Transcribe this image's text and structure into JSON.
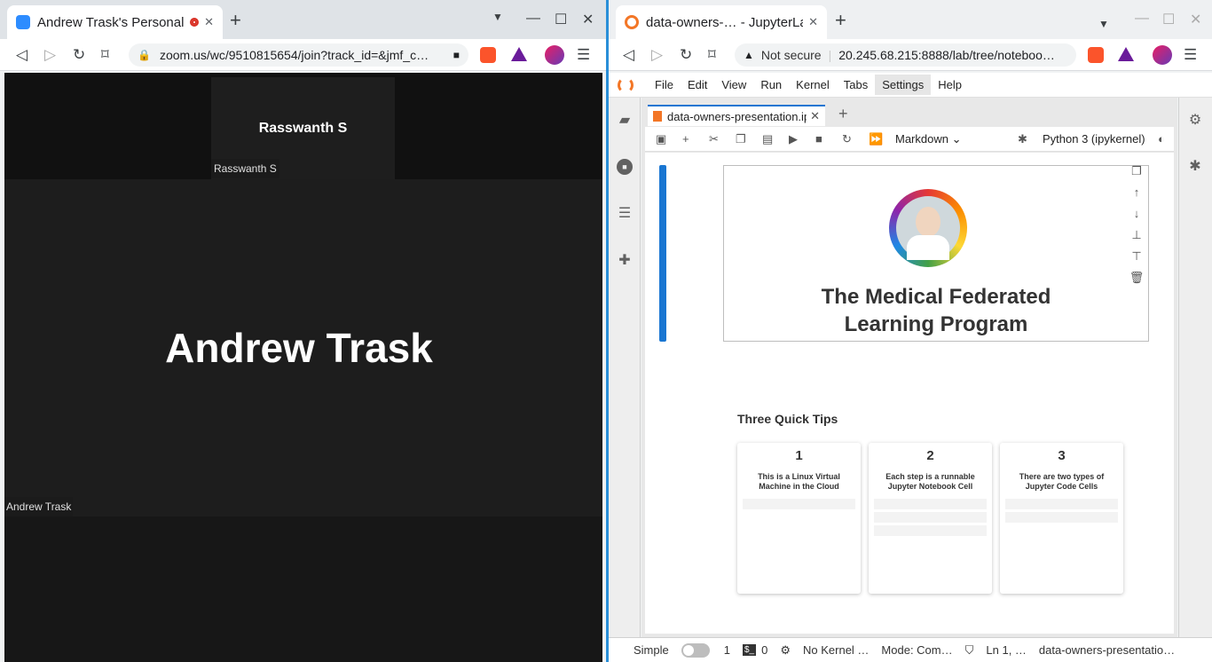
{
  "left": {
    "tab_title": "Andrew Trask's Personal",
    "url": "zoom.us/wc/9510815654/join?track_id=&jmf_c…",
    "speaker_name": "Rasswanth S",
    "speaker_label": "Rasswanth S",
    "main_name": "Andrew Trask",
    "main_label": "Andrew Trask"
  },
  "right": {
    "tab_title": "data-owners-… - JupyterLab",
    "security": "Not secure",
    "url": "20.245.68.215:8888/lab/tree/noteboo…",
    "menu": [
      "File",
      "Edit",
      "View",
      "Run",
      "Kernel",
      "Tabs",
      "Settings",
      "Help"
    ],
    "nb_tab": "data-owners-presentation.ipynb",
    "cell_type": "Markdown",
    "kernel": "Python 3 (ipykernel)",
    "cell_title_1": "The Medical Federated",
    "cell_title_2": "Learning Program",
    "tips_heading": "Three Quick Tips",
    "tips": [
      {
        "num": "1",
        "head": "This is a Linux Virtual Machine in the Cloud"
      },
      {
        "num": "2",
        "head": "Each step is a runnable Jupyter Notebook Cell"
      },
      {
        "num": "3",
        "head": "There are two types of Jupyter Code Cells"
      }
    ],
    "status": {
      "mode_simple": "Simple",
      "n1": "1",
      "n2": "0",
      "kernel_state": "No Kernel …",
      "mode": "Mode: Com…",
      "position": "Ln 1, …",
      "file": "data-owners-presentatio…"
    }
  },
  "colors": {
    "accent": "#1976d2",
    "zoom_bg": "#1a1a1a"
  }
}
